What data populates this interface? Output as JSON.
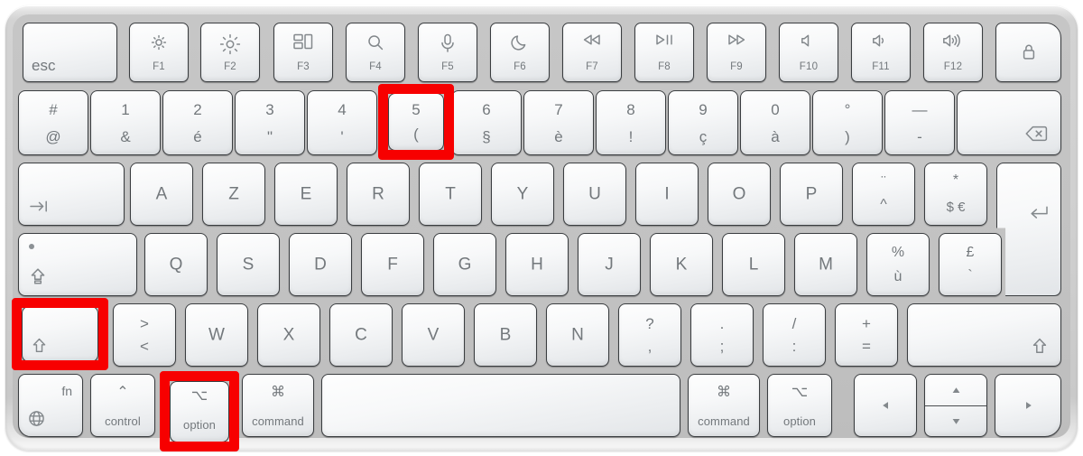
{
  "device": {
    "name": "Apple Magic Keyboard with Touch ID",
    "layout": "AZERTY French",
    "body_color": "#c6c6c6",
    "key_color": "#f4f6f7",
    "legend_color": "#73787c",
    "highlight_color": "#f70000"
  },
  "highlights": [
    {
      "key": "5",
      "label": "5 (",
      "note": "number-five-key"
    },
    {
      "key": "shift-left",
      "label": "shift",
      "note": "left-shift-key"
    },
    {
      "key": "option-left",
      "label": "option",
      "note": "left-option-key"
    }
  ],
  "rows": {
    "function_row": [
      {
        "id": "esc",
        "label": "esc",
        "icon": ""
      },
      {
        "id": "f1",
        "label": "F1",
        "icon": "brightness-down-icon"
      },
      {
        "id": "f2",
        "label": "F2",
        "icon": "brightness-up-icon"
      },
      {
        "id": "f3",
        "label": "F3",
        "icon": "mission-control-icon"
      },
      {
        "id": "f4",
        "label": "F4",
        "icon": "spotlight-search-icon"
      },
      {
        "id": "f5",
        "label": "F5",
        "icon": "dictation-microphone-icon"
      },
      {
        "id": "f6",
        "label": "F6",
        "icon": "do-not-disturb-moon-icon"
      },
      {
        "id": "f7",
        "label": "F7",
        "icon": "rewind-icon"
      },
      {
        "id": "f8",
        "label": "F8",
        "icon": "play-pause-icon"
      },
      {
        "id": "f9",
        "label": "F9",
        "icon": "fast-forward-icon"
      },
      {
        "id": "f10",
        "label": "F10",
        "icon": "mute-icon"
      },
      {
        "id": "f11",
        "label": "F11",
        "icon": "volume-down-icon"
      },
      {
        "id": "f12",
        "label": "F12",
        "icon": "volume-up-icon"
      },
      {
        "id": "touchid",
        "label": "",
        "icon": "touch-id-lock-icon"
      }
    ],
    "number_row": [
      {
        "id": "at",
        "top": "#",
        "bottom": "@"
      },
      {
        "id": "1",
        "top": "1",
        "bottom": "&"
      },
      {
        "id": "2",
        "top": "2",
        "bottom": "é"
      },
      {
        "id": "3",
        "top": "3",
        "bottom": "\""
      },
      {
        "id": "4",
        "top": "4",
        "bottom": "'"
      },
      {
        "id": "5",
        "top": "5",
        "bottom": "("
      },
      {
        "id": "6",
        "top": "6",
        "bottom": "§"
      },
      {
        "id": "7",
        "top": "7",
        "bottom": "è"
      },
      {
        "id": "8",
        "top": "8",
        "bottom": "!"
      },
      {
        "id": "9",
        "top": "9",
        "bottom": "ç"
      },
      {
        "id": "0",
        "top": "0",
        "bottom": "à"
      },
      {
        "id": "degree",
        "top": "°",
        "bottom": ")"
      },
      {
        "id": "minus",
        "top": "—",
        "bottom": "-"
      },
      {
        "id": "delete",
        "top": "",
        "bottom": "",
        "icon": "delete-backspace-icon"
      }
    ],
    "top_letter_row": [
      {
        "id": "tab",
        "label": "",
        "icon": "tab-arrow-icon"
      },
      {
        "id": "a",
        "label": "A"
      },
      {
        "id": "z",
        "label": "Z"
      },
      {
        "id": "e",
        "label": "E"
      },
      {
        "id": "r",
        "label": "R"
      },
      {
        "id": "t",
        "label": "T"
      },
      {
        "id": "y",
        "label": "Y"
      },
      {
        "id": "u",
        "label": "U"
      },
      {
        "id": "i",
        "label": "I"
      },
      {
        "id": "o",
        "label": "O"
      },
      {
        "id": "p",
        "label": "P"
      },
      {
        "id": "circumflex",
        "top": "¨",
        "bottom": "^"
      },
      {
        "id": "dollar",
        "top": "*",
        "bottom": "$ €"
      },
      {
        "id": "return",
        "label": "",
        "icon": "return-arrow-icon"
      }
    ],
    "home_row": [
      {
        "id": "capslock",
        "label": "",
        "icon": "caps-lock-arrow-icon",
        "led": true
      },
      {
        "id": "q",
        "label": "Q"
      },
      {
        "id": "s",
        "label": "S"
      },
      {
        "id": "d",
        "label": "D"
      },
      {
        "id": "f",
        "label": "F"
      },
      {
        "id": "g",
        "label": "G"
      },
      {
        "id": "h",
        "label": "H"
      },
      {
        "id": "j",
        "label": "J"
      },
      {
        "id": "k",
        "label": "K"
      },
      {
        "id": "l",
        "label": "L"
      },
      {
        "id": "m",
        "label": "M"
      },
      {
        "id": "percent",
        "top": "%",
        "bottom": "ù"
      },
      {
        "id": "pound",
        "top": "£",
        "bottom": "`"
      }
    ],
    "bottom_letter_row": [
      {
        "id": "shift-left",
        "label": "",
        "icon": "shift-arrow-icon"
      },
      {
        "id": "lessgreater",
        "top": ">",
        "bottom": "<"
      },
      {
        "id": "w",
        "label": "W"
      },
      {
        "id": "x",
        "label": "X"
      },
      {
        "id": "c",
        "label": "C"
      },
      {
        "id": "v",
        "label": "V"
      },
      {
        "id": "b",
        "label": "B"
      },
      {
        "id": "n",
        "label": "N"
      },
      {
        "id": "comma",
        "top": "?",
        "bottom": ","
      },
      {
        "id": "semicolon",
        "top": ".",
        "bottom": ";"
      },
      {
        "id": "colon",
        "top": "/",
        "bottom": ":"
      },
      {
        "id": "equals",
        "top": "+",
        "bottom": "="
      },
      {
        "id": "shift-right",
        "label": "",
        "icon": "shift-arrow-icon"
      }
    ],
    "modifier_row": [
      {
        "id": "fn",
        "label": "fn",
        "icon": "globe-icon"
      },
      {
        "id": "control",
        "label": "control",
        "symbol": "⌃"
      },
      {
        "id": "option-left",
        "label": "option",
        "symbol": "⌥"
      },
      {
        "id": "command-left",
        "label": "command",
        "symbol": "⌘"
      },
      {
        "id": "space",
        "label": ""
      },
      {
        "id": "command-right",
        "label": "command",
        "symbol": "⌘"
      },
      {
        "id": "option-right",
        "label": "option",
        "symbol": "⌥"
      },
      {
        "id": "arrow-left",
        "label": "",
        "icon": "arrow-left-icon"
      },
      {
        "id": "arrow-updown",
        "label": "",
        "icon": "arrow-up-down-icon"
      },
      {
        "id": "arrow-right",
        "label": "",
        "icon": "arrow-right-icon"
      }
    ]
  }
}
